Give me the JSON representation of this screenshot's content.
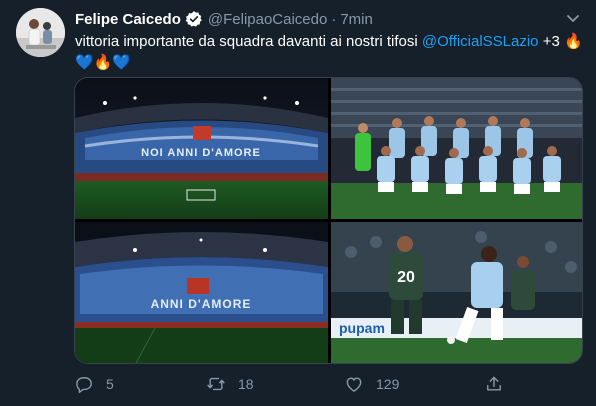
{
  "tweet": {
    "display_name": "Felipe Caicedo",
    "handle": "@FelipaoCaicedo",
    "separator": "·",
    "time": "7min",
    "text_main": "vittoria importante da squadra davanti ai nostri tifosi ",
    "mention": "@OfficialSSLazio",
    "text_after_mention": " +3 ",
    "emoji_line2": [
      "💙",
      "🔥",
      "💙"
    ],
    "emoji_fire": "🔥",
    "media": [
      {
        "name": "stadium-choreography-photo",
        "banner": "NOI ANNI D'AMORE"
      },
      {
        "name": "team-photo"
      },
      {
        "name": "stadium-choreography-wide-photo",
        "banner": "ANNI D'AMORE"
      },
      {
        "name": "match-action-photo",
        "jersey_number": "20",
        "board_text": "pupam"
      }
    ]
  },
  "actions": {
    "reply_count": "5",
    "retweet_count": "18",
    "like_count": "129",
    "share_label": ""
  },
  "colors": {
    "background": "#15202b",
    "accent": "#1da1f2",
    "muted": "#8899a6"
  },
  "icons": [
    "verified-badge-icon",
    "chevron-down-icon",
    "reply-icon",
    "retweet-icon",
    "like-icon",
    "share-icon"
  ]
}
